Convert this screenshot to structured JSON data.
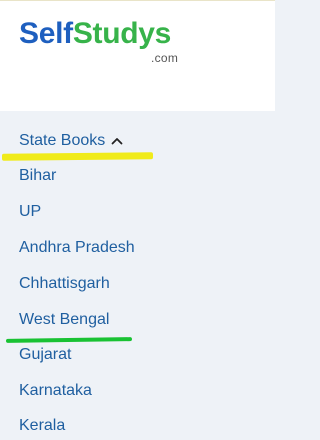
{
  "logo": {
    "part1": "Self",
    "part2": "Studys",
    "suffix": ".com"
  },
  "menu": {
    "header": {
      "label": "State Books",
      "icon": "chevron-up-icon"
    },
    "items": [
      {
        "label": "Bihar"
      },
      {
        "label": "UP"
      },
      {
        "label": "Andhra Pradesh"
      },
      {
        "label": "Chhattisgarh"
      },
      {
        "label": "West Bengal"
      },
      {
        "label": "Gujarat"
      },
      {
        "label": "Karnataka"
      },
      {
        "label": "Kerala"
      }
    ]
  },
  "colors": {
    "brand_blue": "#1e5fbf",
    "brand_green": "#37b34a",
    "link": "#1f5fa0",
    "highlight_yellow": "#f0eb1a",
    "highlight_green": "#19c233",
    "panel_bg": "#eef2f7"
  }
}
